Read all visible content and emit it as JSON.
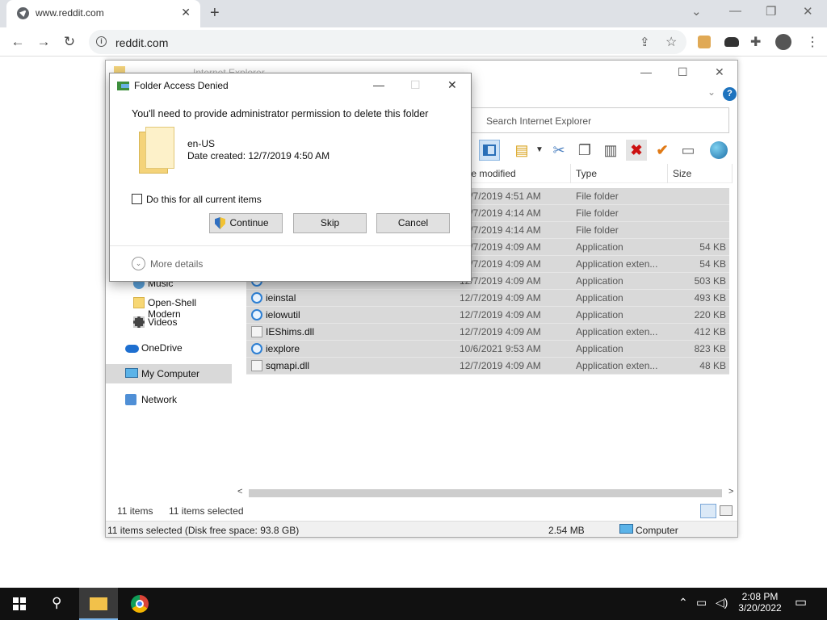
{
  "browser": {
    "tab_title": "www.reddit.com",
    "url": "reddit.com"
  },
  "explorer": {
    "title": "Internet Explorer",
    "search_placeholder": "Search Internet Explorer",
    "columns": {
      "date": "te modified",
      "type": "Type",
      "size": "Size"
    },
    "rows": [
      {
        "name": "",
        "date": "12/7/2019 4:51 AM",
        "type": "File folder",
        "size": "",
        "icon": "folder"
      },
      {
        "name": "",
        "date": "12/7/2019 4:14 AM",
        "type": "File folder",
        "size": "",
        "icon": "folder"
      },
      {
        "name": "",
        "date": "12/7/2019 4:14 AM",
        "type": "File folder",
        "size": "",
        "icon": "folder"
      },
      {
        "name": "",
        "date": "12/7/2019 4:09 AM",
        "type": "Application",
        "size": "54 KB",
        "icon": "ie"
      },
      {
        "name": "",
        "date": "12/7/2019 4:09 AM",
        "type": "Application exten...",
        "size": "54 KB",
        "icon": "dll"
      },
      {
        "name": "",
        "date": "12/7/2019 4:09 AM",
        "type": "Application",
        "size": "503 KB",
        "icon": "ie"
      },
      {
        "name": "ieinstal",
        "date": "12/7/2019 4:09 AM",
        "type": "Application",
        "size": "493 KB",
        "icon": "ie"
      },
      {
        "name": "ielowutil",
        "date": "12/7/2019 4:09 AM",
        "type": "Application",
        "size": "220 KB",
        "icon": "ie"
      },
      {
        "name": "IEShims.dll",
        "date": "12/7/2019 4:09 AM",
        "type": "Application exten...",
        "size": "412 KB",
        "icon": "dll"
      },
      {
        "name": "iexplore",
        "date": "10/6/2021 9:53 AM",
        "type": "Application",
        "size": "823 KB",
        "icon": "ie"
      },
      {
        "name": "sqmapi.dll",
        "date": "12/7/2019 4:09 AM",
        "type": "Application exten...",
        "size": "48 KB",
        "icon": "dll"
      }
    ],
    "nav": {
      "music": "Music",
      "openshell": "Open-Shell Modern",
      "videos": "Videos",
      "onedrive": "OneDrive",
      "mycomputer": "My Computer",
      "network": "Network"
    },
    "status": {
      "items": "11 items",
      "selected": "11 items selected",
      "bottom_left": "11 items selected (Disk free space: 93.8 GB)",
      "bottom_size": "2.54 MB",
      "bottom_location": "Computer"
    }
  },
  "dialog": {
    "title": "Folder Access Denied",
    "message": "You'll need to provide administrator permission to delete this folder",
    "folder_name": "en-US",
    "folder_date": "Date created: 12/7/2019 4:50 AM",
    "checkbox_label": "Do this for all current items",
    "continue": "Continue",
    "skip": "Skip",
    "cancel": "Cancel",
    "more_details": "More details"
  },
  "taskbar": {
    "time": "2:08 PM",
    "date": "3/20/2022"
  }
}
